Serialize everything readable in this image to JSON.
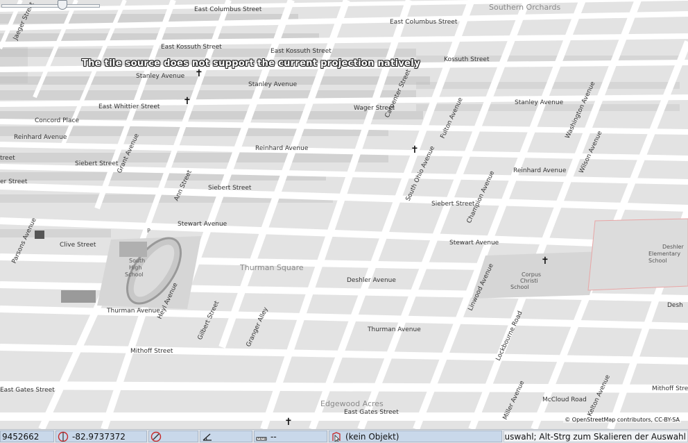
{
  "map": {
    "projection_warning": "The tile source does not support the current projection natively",
    "attribution": "© OpenStreetMap contributors, CC-BY-SA",
    "area_labels": {
      "southern_orchards": "Southern Orchards",
      "thurman_square": "Thurman Square",
      "edgewood_acres": "Edgewood Acres"
    },
    "street_labels": {
      "east_columbus_1": "East Columbus Street",
      "east_columbus_2": "East Columbus Street",
      "east_kossuth_1": "East Kossuth Street",
      "east_kossuth_2": "East Kossuth Street",
      "kossuth": "Kossuth Street",
      "stanley_1": "Stanley Avenue",
      "stanley_2": "Stanley Avenue",
      "stanley_3": "Stanley Avenue",
      "east_whittier": "East Whittier Street",
      "wager": "Wager Street",
      "concord": "Concord Place",
      "reinhard_1": "Reinhard Avenue",
      "reinhard_2": "Reinhard Avenue",
      "reinhard_3": "Reinhard Avenue",
      "siebert_1": "Siebert Street",
      "siebert_2": "Siebert Street",
      "siebert_3": "Siebert Street",
      "siebert_4": "er Street",
      "stewart_1": "Stewart Avenue",
      "stewart_2": "Stewart Avenue",
      "clive": "Clive Street",
      "deshler_1": "Deshler Avenue",
      "deshler_2": "Desh",
      "thurman_1": "Thurman Avenue",
      "thurman_2": "Thurman Avenue",
      "mithoff_1": "Mithoff Street",
      "mithoff_2": "Mithoff Street",
      "mccloud": "McCloud Road",
      "east_gates_1": "East Gates Street",
      "east_gates_2": "East Gates Street",
      "treet": "treet",
      "lockbourne": "Lockbourne Road",
      "washington": "Washington Avenue",
      "heyl": "Heyl Avenue",
      "ann": "Ann Street",
      "grant": "Grant Avenue",
      "gilbert": "Gilbert Street",
      "fulton": "Fulton Avenue",
      "ohio": "South Ohio Avenue",
      "champion": "Champion Avenue",
      "linwood": "Linwood Avenue",
      "kelton": "Kelton Avenue",
      "miller": "Miller Avenue",
      "wilson": "Wilson Avenue",
      "carpenter": "Carpenter Street",
      "granger": "Granger Alley",
      "parsons": "Parsons Avenue",
      "jaeger": "Jaeger Street"
    },
    "poi_labels": {
      "south_high_1": "South",
      "south_high_2": "High",
      "south_high_3": "School",
      "corpus_1": "Corpus",
      "corpus_2": "Christi",
      "corpus_3": "School",
      "deshler_school_1": "Deshler",
      "deshler_school_2": "Elementary",
      "deshler_school_3": "School",
      "parking": "P"
    }
  },
  "zoom": {
    "level_fraction": 0.63
  },
  "statusbar": {
    "latitude": "9452662",
    "longitude": "-82.9737372",
    "heading": "",
    "angle": "",
    "distance": "--",
    "selection": "(kein Objekt)",
    "help": "<Strg>+<Alt>-Umschalttaste-Strg zum Drehen der Auswahl; Alt-Strg zum Skalieren der Auswahl"
  },
  "icons": {
    "latitude": "lat-compass-icon",
    "longitude": "lon-compass-icon",
    "heading": "heading-compass-icon",
    "angle": "angle-icon",
    "distance": "ruler-icon",
    "selection": "selection-icon"
  },
  "colors": {
    "road": "#ffffff",
    "background": "#e3e3e3",
    "building": "#b4b4b4",
    "school_area": "#d9d9d9",
    "status_cell": "#c9d8ea"
  }
}
